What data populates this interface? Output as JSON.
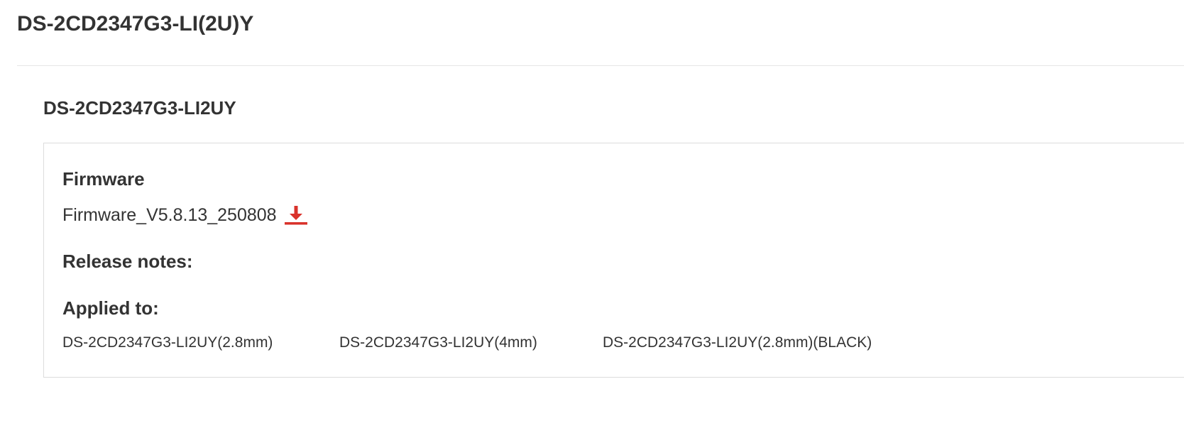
{
  "page": {
    "title": "DS-2CD2347G3-LI(2U)Y"
  },
  "model": {
    "title": "DS-2CD2347G3-LI2UY"
  },
  "firmware_card": {
    "firmware_heading": "Firmware",
    "firmware_name": "Firmware_V5.8.13_250808",
    "download_icon": "download-icon",
    "release_notes_heading": "Release notes:",
    "applied_to_heading": "Applied to:",
    "applied_to": [
      "DS-2CD2347G3-LI2UY(2.8mm)",
      "DS-2CD2347G3-LI2UY(4mm)",
      "DS-2CD2347G3-LI2UY(2.8mm)(BLACK)"
    ]
  },
  "colors": {
    "text": "#333333",
    "accent_red": "#d9322b",
    "border": "#dcdcdc",
    "divider": "#e5e5e5"
  }
}
